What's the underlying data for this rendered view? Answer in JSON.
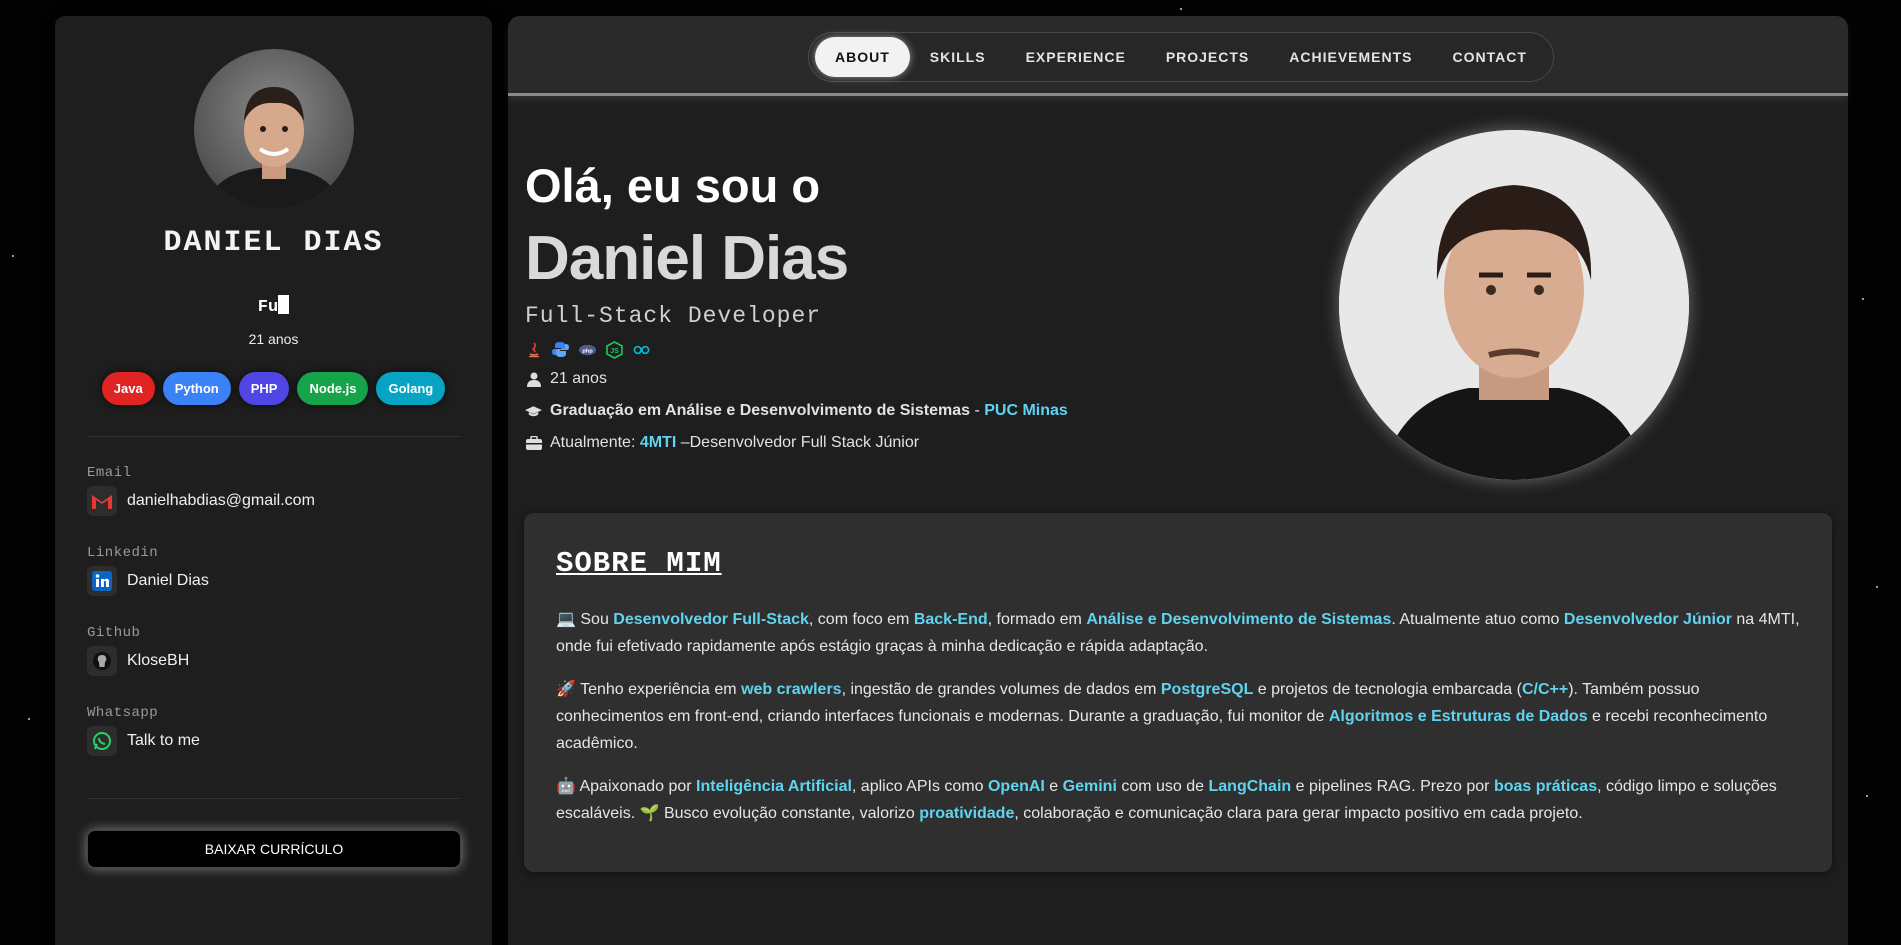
{
  "sidebar": {
    "name": "DANIEL DIAS",
    "typed_text": "Fu",
    "age": "21 anos",
    "tags": [
      {
        "label": "Java",
        "color": "#e02424"
      },
      {
        "label": "Python",
        "color": "#3b82f6"
      },
      {
        "label": "PHP",
        "color": "#5046e5"
      },
      {
        "label": "Node.js",
        "color": "#16a34a"
      },
      {
        "label": "Golang",
        "color": "#06a3c4"
      }
    ],
    "contacts": {
      "email_label": "Email",
      "email_value": "danielhabdias@gmail.com",
      "linkedin_label": "Linkedin",
      "linkedin_value": "Daniel Dias",
      "github_label": "Github",
      "github_value": "KloseBH",
      "whatsapp_label": "Whatsapp",
      "whatsapp_value": "Talk to me"
    },
    "download_label": "BAIXAR CURRÍCULO"
  },
  "nav": {
    "items": [
      "ABOUT",
      "SKILLS",
      "EXPERIENCE",
      "PROJECTS",
      "ACHIEVEMENTS",
      "CONTACT"
    ],
    "active": "ABOUT"
  },
  "hero": {
    "greeting": "Olá, eu sou o",
    "name": "Daniel Dias",
    "role": "Full-Stack Developer",
    "tech_icons": [
      "java-icon",
      "python-icon",
      "php-icon",
      "nodejs-icon",
      "golang-icon"
    ],
    "age": "21 anos",
    "education": {
      "course": "Graduação em Análise e Desenvolvimento de Sistemas",
      "separator": " - ",
      "school": "PUC Minas"
    },
    "current": {
      "prefix": "Atualmente: ",
      "company": "4MTI",
      "suffix": " –Desenvolvedor Full Stack Júnior"
    }
  },
  "about": {
    "title": "SOBRE MIM",
    "p1": {
      "emoji": "💻",
      "t1": " Sou ",
      "h1": "Desenvolvedor Full-Stack",
      "t2": ", com foco em ",
      "h2": "Back-End",
      "t3": ", formado em ",
      "h3": "Análise e Desenvolvimento de Sistemas",
      "t4": ". Atualmente atuo como ",
      "h4": "Desenvolvedor Júnior",
      "t5": " na 4MTI, onde fui efetivado rapidamente após estágio graças à minha dedicação e rápida adaptação."
    },
    "p2": {
      "emoji": "🚀",
      "t1": " Tenho experiência em ",
      "h1": "web crawlers",
      "t2": ", ingestão de grandes volumes de dados em ",
      "h2": "PostgreSQL",
      "t3": " e projetos de tecnologia embarcada (",
      "h3": "C/C++",
      "t4": "). Também possuo conhecimentos em front-end, criando interfaces funcionais e modernas. Durante a graduação, fui monitor de ",
      "h4": "Algoritmos e Estruturas de Dados",
      "t5": " e recebi reconhecimento acadêmico."
    },
    "p3": {
      "emoji": "🤖",
      "t1": " Apaixonado por ",
      "h1": "Inteligência Artificial",
      "t2": ", aplico APIs como ",
      "h2": "OpenAI",
      "t3": " e ",
      "h3": "Gemini",
      "t4": " com uso de ",
      "h4": "LangChain",
      "t5": " e pipelines RAG. Prezo por ",
      "h5": "boas práticas",
      "t6": ", código limpo e soluções escaláveis. ",
      "emoji2": "🌱",
      "t7": " Busco evolução constante, valorizo ",
      "h6": "proatividade",
      "t8": ", colaboração e comunicação clara para gerar impacto positivo em cada projeto."
    }
  },
  "colors": {
    "accent": "#5fd4f0",
    "background": "#020203",
    "panel": "#1e1e1e",
    "card": "#2f2f2f"
  }
}
